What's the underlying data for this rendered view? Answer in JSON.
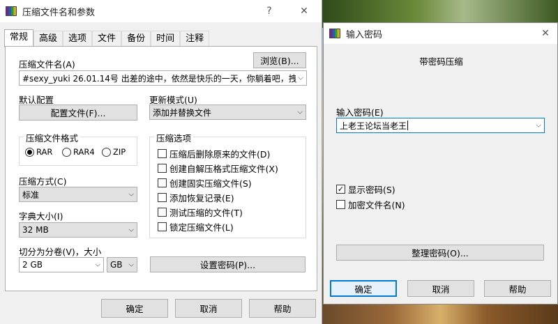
{
  "main": {
    "title": "压缩文件名和参数",
    "help_btn": "?",
    "close_btn": "✕",
    "tabs": [
      "常规",
      "高级",
      "选项",
      "文件",
      "备份",
      "时间",
      "注释"
    ],
    "archive_name_label": "压缩文件名(A)",
    "browse_label": "浏览(B)...",
    "archive_name_value": "#sexy_yuki 26.01.14号 出差的途中，依然是快乐的一天，你躺着吧，拽",
    "default_profile_label": "默认配置",
    "profiles_button": "配置文件(F)...",
    "update_mode_label": "更新模式(U)",
    "update_mode_value": "添加并替换文件",
    "format_group_title": "压缩文件格式",
    "format_options": [
      "RAR",
      "RAR4",
      "ZIP"
    ],
    "method_label": "压缩方式(C)",
    "method_value": "标准",
    "dict_label": "字典大小(I)",
    "dict_value": "32 MB",
    "split_label": "切分为分卷(V)，大小",
    "split_value": "2 GB",
    "split_unit": "GB",
    "options_group_title": "压缩选项",
    "options": [
      {
        "label": "压缩后删除原来的文件(D)",
        "checked": false
      },
      {
        "label": "创建自解压格式压缩文件(X)",
        "checked": false
      },
      {
        "label": "创建固实压缩文件(S)",
        "checked": false
      },
      {
        "label": "添加恢复记录(E)",
        "checked": false
      },
      {
        "label": "测试压缩的文件(T)",
        "checked": false
      },
      {
        "label": "锁定压缩文件(L)",
        "checked": false
      }
    ],
    "set_password_button": "设置密码(P)...",
    "ok": "确定",
    "cancel": "取消",
    "help": "帮助"
  },
  "password": {
    "title": "输入密码",
    "close_btn": "✕",
    "heading": "带密码压缩",
    "input_label": "输入密码(E)",
    "input_value": "上老王论坛当老王",
    "show_password": {
      "label": "显示密码(S)",
      "checked": true
    },
    "encrypt_names": {
      "label": "加密文件名(N)",
      "checked": false
    },
    "organize_button": "整理密码(O)...",
    "ok": "确定",
    "cancel": "取消",
    "help": "帮助"
  }
}
